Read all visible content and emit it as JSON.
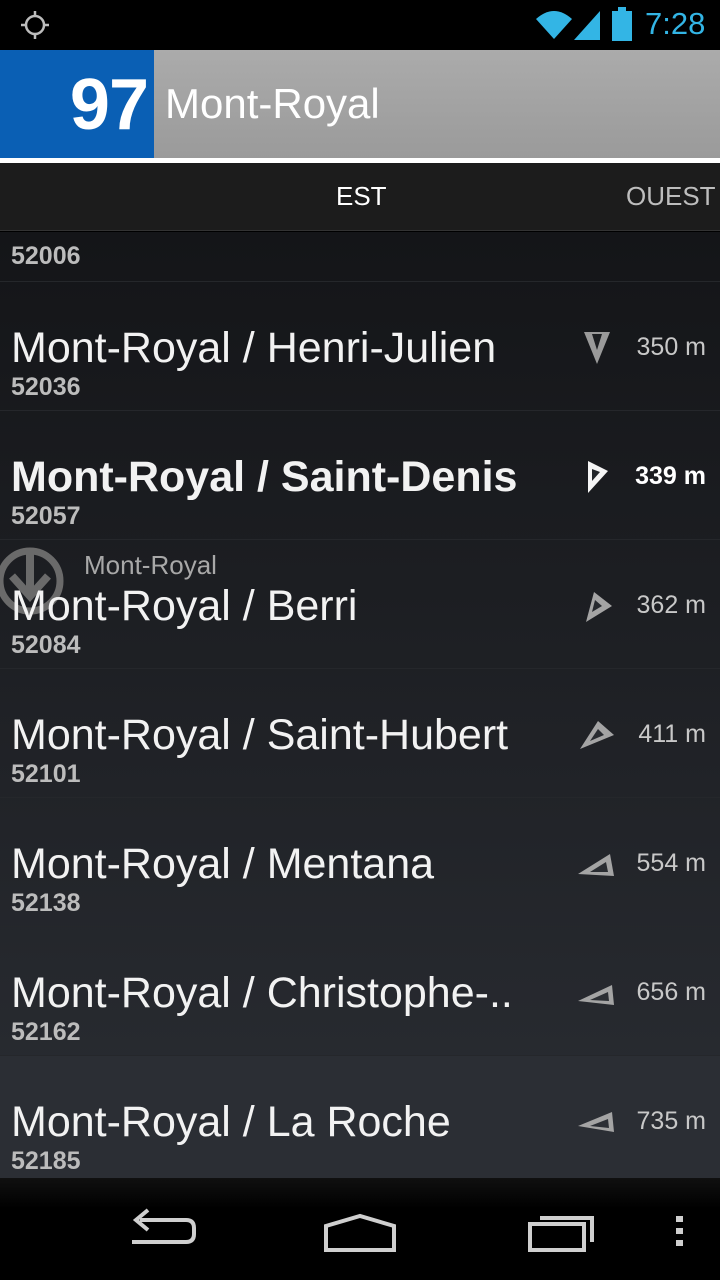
{
  "status_bar": {
    "time": "7:28",
    "icons": [
      "gps-icon",
      "wifi-icon",
      "signal-icon",
      "battery-icon"
    ],
    "accent_color": "#33b5e5"
  },
  "header": {
    "route_number": "97",
    "route_name": "Mont-Royal",
    "route_color": "#0a5fb4"
  },
  "tabs": [
    {
      "label": "EST",
      "selected": true
    },
    {
      "label": "OUEST",
      "selected": false
    }
  ],
  "stops_partial": {
    "code": "52006"
  },
  "stops": [
    {
      "name": "Mont-Royal / Henri-Julien",
      "code": "52036",
      "distance": "350 m",
      "highlight": false
    },
    {
      "name": "Mont-Royal / Saint-Denis",
      "code": "52057",
      "distance": "339 m",
      "highlight": true
    },
    {
      "name": "Mont-Royal / Berri",
      "code": "52084",
      "distance": "362 m",
      "highlight": false,
      "metro": "Mont-Royal"
    },
    {
      "name": "Mont-Royal / Saint-Hubert",
      "code": "52101",
      "distance": "411 m",
      "highlight": false
    },
    {
      "name": "Mont-Royal / Mentana",
      "code": "52138",
      "distance": "554 m",
      "highlight": false
    },
    {
      "name": "Mont-Royal / Christophe-..",
      "code": "52162",
      "distance": "656 m",
      "highlight": false
    },
    {
      "name": "Mont-Royal / La Roche",
      "code": "52185",
      "distance": "735 m",
      "highlight": false
    }
  ],
  "nav_bar": {
    "icons": [
      "back-icon",
      "home-icon",
      "recents-icon",
      "overflow-menu-icon"
    ]
  }
}
